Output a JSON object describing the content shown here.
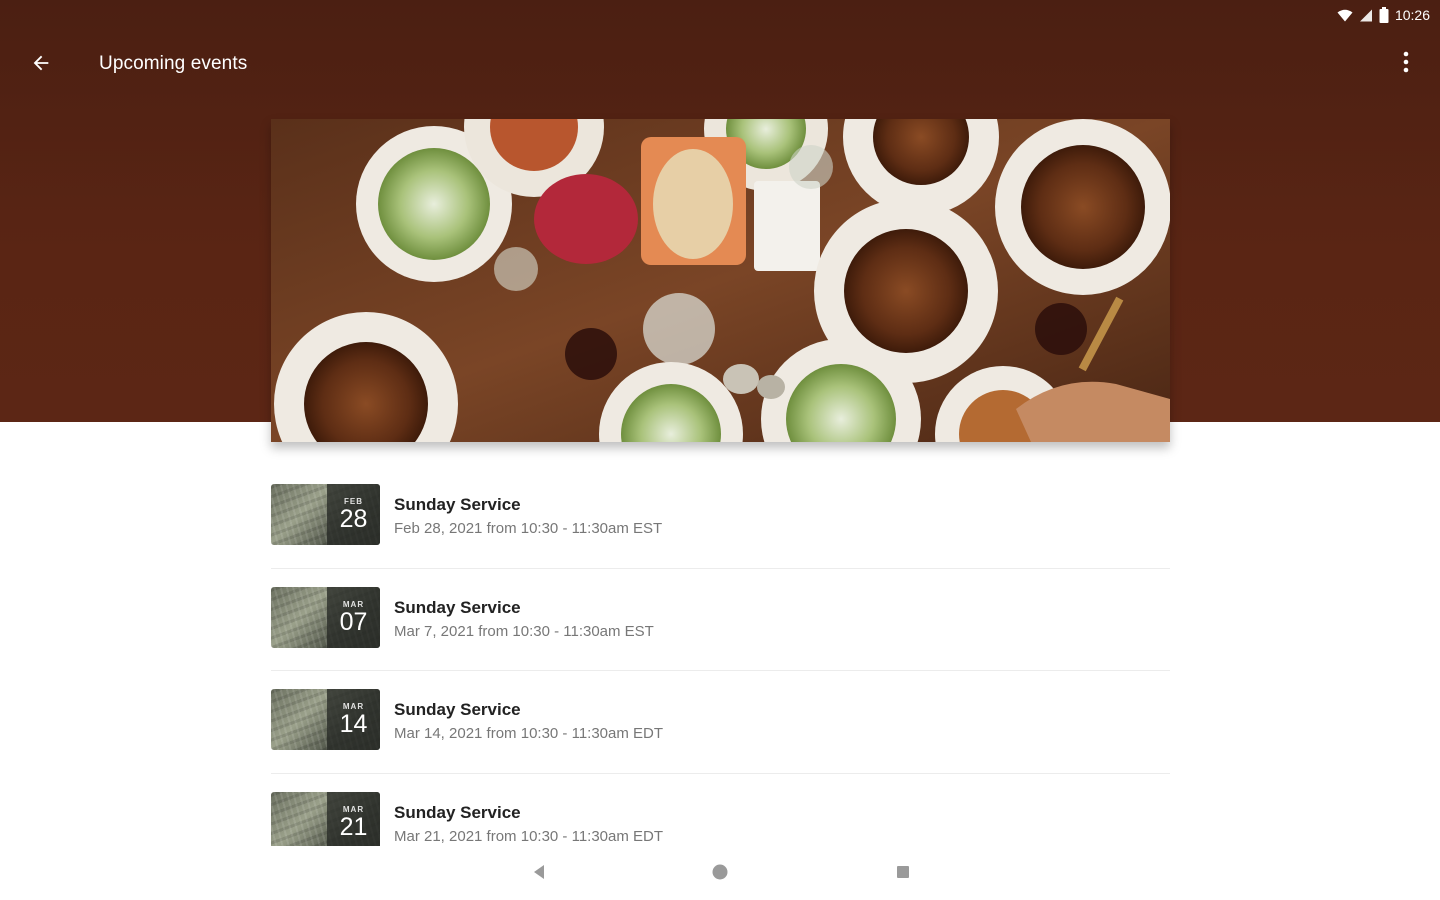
{
  "status_bar": {
    "time": "10:26",
    "wifi_icon": "wifi-icon",
    "signal_icon": "signal-icon",
    "battery_icon": "battery-icon"
  },
  "app_bar": {
    "title": "Upcoming events",
    "back_icon": "back-arrow-icon",
    "more_icon": "more-vert-icon"
  },
  "hero": {
    "description_icon": "food-table-image"
  },
  "events": [
    {
      "month": "FEB",
      "day": "28",
      "title": "Sunday Service",
      "subtitle": "Feb 28, 2021 from 10:30 - 11:30am EST"
    },
    {
      "month": "MAR",
      "day": "07",
      "title": "Sunday Service",
      "subtitle": "Mar 7, 2021 from 10:30 - 11:30am EST"
    },
    {
      "month": "MAR",
      "day": "14",
      "title": "Sunday Service",
      "subtitle": "Mar 14, 2021 from 10:30 - 11:30am EDT"
    },
    {
      "month": "MAR",
      "day": "21",
      "title": "Sunday Service",
      "subtitle": "Mar 21, 2021 from 10:30 - 11:30am EDT"
    }
  ],
  "nav_bar": {
    "back_icon": "nav-back-icon",
    "home_icon": "nav-home-icon",
    "recents_icon": "nav-recents-icon"
  },
  "colors": {
    "header_bg": "#5a2514",
    "list_divider": "#ececec"
  }
}
